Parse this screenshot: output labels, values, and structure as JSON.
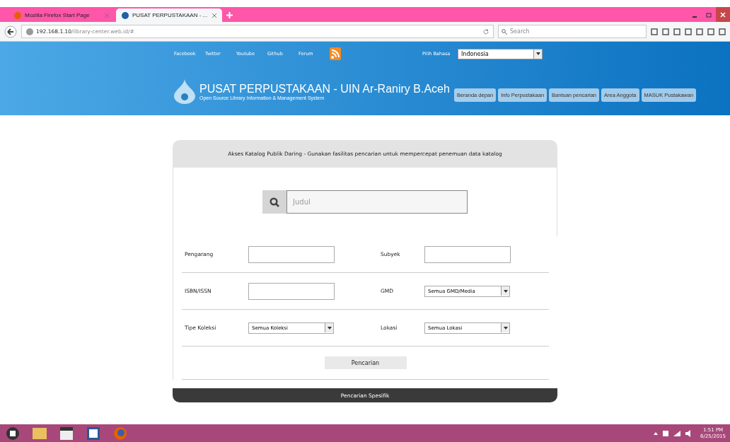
{
  "browser": {
    "tabs": [
      {
        "title": "Mozilla Firefox Start Page",
        "selected": false
      },
      {
        "title": "PUSAT PERPUSTAKAAN - ...",
        "selected": true
      }
    ],
    "address": {
      "host": "192.168.1.10",
      "path": "/library-center.web.id/#"
    },
    "search": {
      "placeholder": "Search"
    }
  },
  "header": {
    "social_links": [
      "Facebook",
      "Twitter",
      "Youtube",
      "Github",
      "Forum"
    ],
    "language_label": "Pilih Bahasa",
    "language": "Indonesia",
    "title": "PUSAT PERPUSTAKAAN - UIN Ar-Raniry B.Aceh",
    "subtitle": "Open Source Library Information & Management System",
    "nav": [
      "Beranda depan",
      "Info Perpustakaan",
      "Bantuan pencarian",
      "Area Anggota",
      "MASUK Pustakawan"
    ]
  },
  "catalog": {
    "heading": "Akses Katalog Publik Daring - Gunakan fasilitas pencarian untuk mempercepat penemuan data katalog",
    "search_placeholder": "Judul",
    "fields": [
      [
        {
          "label": "Pengarang",
          "kind": "text"
        },
        {
          "label": "Subyek",
          "kind": "text"
        }
      ],
      [
        {
          "label": "ISBN/ISSN",
          "kind": "text"
        },
        {
          "label": "GMD",
          "kind": "select",
          "value": "Semua GMD/Media"
        }
      ],
      [
        {
          "label": "Tipe Koleksi",
          "kind": "select",
          "value": "Semua Koleksi"
        },
        {
          "label": "Lokasi",
          "kind": "select",
          "value": "Semua Lokasi"
        }
      ]
    ],
    "submit": "Pencarian",
    "footer": "Pencarian Spesifik"
  },
  "taskbar": {
    "time": "1:51 PM",
    "date": "6/25/2015"
  }
}
